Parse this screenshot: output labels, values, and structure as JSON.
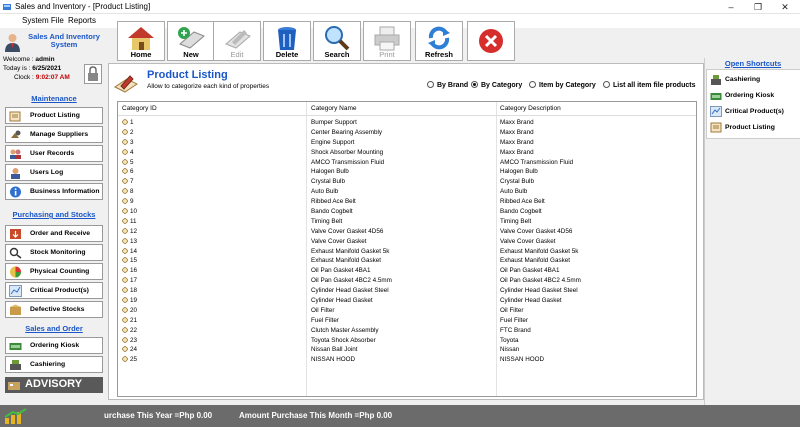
{
  "window": {
    "title": "Sales and Inventory - [Product Listing]"
  },
  "menu": [
    "System File",
    "Reports"
  ],
  "user": {
    "system_title": "Sales And Inventory System",
    "welcome_label": "Welcome :",
    "welcome_value": "admin",
    "today_label": "Today is :",
    "today_value": "6/25/2021",
    "clock_label": "Clock :",
    "clock_value": "9:02:07 AM"
  },
  "toolbar": [
    {
      "label": "Home",
      "icon": "home-icon",
      "enabled": true
    },
    {
      "label": "New",
      "icon": "new-icon",
      "enabled": true
    },
    {
      "label": "Edit",
      "icon": "edit-icon",
      "enabled": false
    },
    {
      "label": "Delete",
      "icon": "trash-icon",
      "enabled": true
    },
    {
      "label": "Search",
      "icon": "magnifier-icon",
      "enabled": true
    },
    {
      "label": "Print",
      "icon": "printer-icon",
      "enabled": false
    },
    {
      "label": "Refresh",
      "icon": "refresh-icon",
      "enabled": true
    },
    {
      "label": "",
      "icon": "close-icon",
      "enabled": true
    }
  ],
  "sidebar": {
    "maintenance_title": "Maintenance",
    "maintenance": [
      "Product Listing",
      "Manage Suppliers",
      "User Records",
      "Users Log",
      "Business Information"
    ],
    "purchasing_title": "Purchasing and Stocks",
    "purchasing": [
      "Order and Receive",
      "Stock Monitoring",
      "Physical Counting",
      "Critical Product(s)",
      "Defective Stocks"
    ],
    "sales_title": "Sales and Order",
    "sales": [
      "Ordering Kiosk",
      "Cashiering"
    ],
    "advisory": "ADVISORY"
  },
  "main": {
    "title": "Product Listing",
    "subtitle": "Allow to categorize each kind of properties",
    "filters": [
      {
        "label": "By Brand",
        "selected": false
      },
      {
        "label": "By Category",
        "selected": true
      },
      {
        "label": "Item by Category",
        "selected": false
      },
      {
        "label": "List all  item file products",
        "selected": false
      }
    ],
    "columns": [
      "Category ID",
      "Category Name",
      "Category Description"
    ],
    "rows": [
      [
        "1",
        "Bumper Support",
        "Maxx Brand"
      ],
      [
        "2",
        "Center Bearing Assembly",
        "Maxx Brand"
      ],
      [
        "3",
        "Engine Support",
        "Maxx Brand"
      ],
      [
        "4",
        "Shock Absorber Mounting",
        "Maxx Brand"
      ],
      [
        "5",
        "AMCO Transmission Fluid",
        "AMCO Transmission Fluid"
      ],
      [
        "6",
        "Halogen Bulb",
        "Halogen Bulb"
      ],
      [
        "7",
        "Crystal Bulb",
        "Crystal Bulb"
      ],
      [
        "8",
        "Auto Bulb",
        "Auto Bulb"
      ],
      [
        "9",
        "Ribbed Ace Belt",
        "Ribbed Ace Belt"
      ],
      [
        "10",
        "Bando Cogbelt",
        "Bando Cogbelt"
      ],
      [
        "11",
        "Timing Belt",
        "Timing Belt"
      ],
      [
        "12",
        "Valve Cover Gasket 4D56",
        "Valve Cover Gasket 4D56"
      ],
      [
        "13",
        "Valve Cover Gasket",
        "Valve Cover Gasket"
      ],
      [
        "14",
        "Exhaust Manifold Gasket 5k",
        "Exhaust Manifold Gasket 5k"
      ],
      [
        "15",
        "Exhaust Manifold Gasket",
        "Exhaust Manifold Gasket"
      ],
      [
        "16",
        "Oil Pan Gasket 4BA1",
        "Oil Pan Gasket 4BA1"
      ],
      [
        "17",
        "Oil Pan Gasket 4BC2 4.5mm",
        "Oil Pan Gasket 4BC2 4.5mm"
      ],
      [
        "18",
        "Cylinder Head Gasket Steel",
        "Cylinder Head Gasket Steel"
      ],
      [
        "19",
        "Cylinder Head Gasket",
        "Cylinder Head Gasket"
      ],
      [
        "20",
        "Oil Filter",
        "Oil Filter"
      ],
      [
        "21",
        "Fuel Filter",
        "Fuel Filter"
      ],
      [
        "22",
        "Clutch Master Assembly",
        "FTC Brand"
      ],
      [
        "23",
        "Toyota Shock Absorber",
        "Toyota"
      ],
      [
        "24",
        "Nissan Ball Joint",
        "Nissan"
      ],
      [
        "25",
        "NISSAN HOOD",
        "NISSAN HOOD"
      ]
    ]
  },
  "shortcuts": {
    "title": "Open Shortcuts",
    "items": [
      "Cashiering",
      "Ordering Kiosk",
      "Critical Product(s)",
      "Product Listing"
    ]
  },
  "status": {
    "purchase_year": "urchase This Year =Php 0.00",
    "purchase_month": "Amount Purchase This Month =Php 0.00"
  },
  "colors": {
    "accent": "#1a56c8",
    "clock": "#c00000",
    "statusbar": "#6b6b6b"
  }
}
